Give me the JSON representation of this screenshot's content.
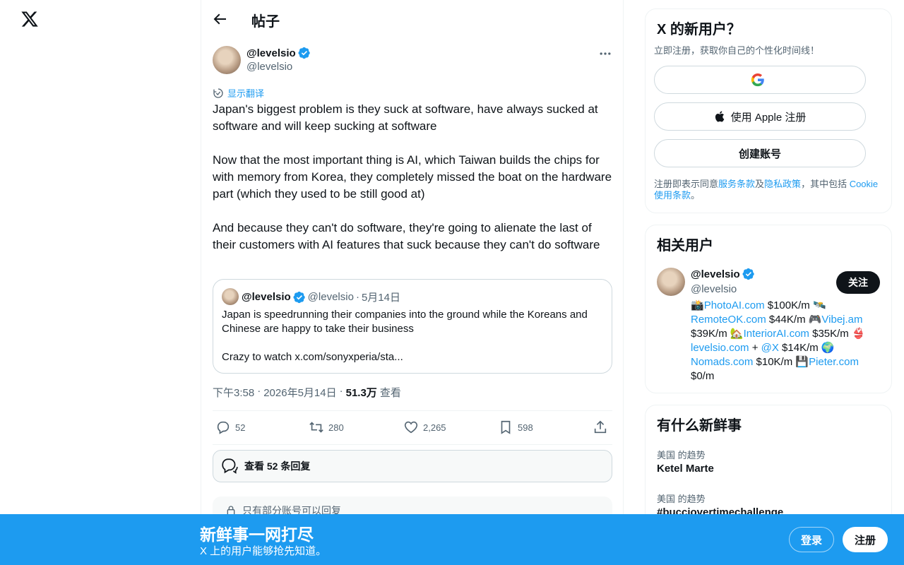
{
  "header": {
    "title": "帖子"
  },
  "tweet": {
    "author_name": "@levelsio",
    "author_handle": "@levelsio",
    "translate_label": "显示翻译",
    "paragraphs": [
      "Japan's biggest problem is they suck at software, have always sucked at software and will keep sucking at software",
      "Now that the most important thing is AI, which Taiwan builds the chips for with memory from Korea, they completely missed the boat on the hardware part (which they used to be still good at)",
      "And because they can't do software, they're going to alienate the last of their customers with AI features that suck because they can't do software"
    ],
    "quote": {
      "name": "@levelsio",
      "handle": "@levelsio",
      "dot": "·",
      "date": "5月14日",
      "paragraphs": [
        "Japan is speedrunning their companies into the ground while the Koreans and Chinese are happy to take their business",
        "Crazy to watch x.com/sonyxperia/sta..."
      ]
    },
    "meta": {
      "time": "下午3:58",
      "sep1": "·",
      "date": "2026年5月14日",
      "sep2": "·",
      "views": "51.3万",
      "views_label": "查看"
    },
    "actions": {
      "replies": "52",
      "retweets": "280",
      "likes": "2,265",
      "bookmarks": "598"
    },
    "view_replies_label": "查看 52 条回复",
    "restricted_label": "只有部分账号可以回复"
  },
  "signup": {
    "title": "X 的新用户？",
    "subtitle": "立即注册，获取你自己的个性化时间线！",
    "google_label": "",
    "apple_label": "使用 Apple 注册",
    "create_label": "创建账号",
    "terms_prefix": "注册即表示同意",
    "terms_link": "服务条款",
    "terms_and": "及",
    "privacy_link": "隐私政策",
    "terms_mid": "，其中包括 ",
    "cookie_link": "Cookie 使用条款",
    "terms_end": "。"
  },
  "related": {
    "title": "相关用户",
    "name": "@levelsio",
    "handle": "@levelsio",
    "follow_label": "关注",
    "bio": {
      "e1": "📸",
      "l1": "PhotoAI.com",
      "t1": " $100K/m ",
      "e2": "🛰️",
      "l2": "RemoteOK.com",
      "t2": " $44K/m ",
      "e3": "🎮",
      "l3": "Vibej.am",
      "t3": " $39K/m ",
      "e4": "🏡",
      "l4": "InteriorAI.com",
      "t4": " $35K/m ",
      "e5": "👙",
      "l5": "levelsio.com",
      "t5a": " + ",
      "l6": "@X",
      "t5": " $14K/m ",
      "e6": "🌍",
      "l7": "Nomads.com",
      "t6": " $10K/m ",
      "e7": "💾",
      "l8": "Pieter.com",
      "t7": " $0/m"
    }
  },
  "trends": {
    "title": "有什么新鲜事",
    "items": [
      {
        "context": "美国 的趋势",
        "name": "Ketel Marte"
      },
      {
        "context": "美国 的趋势",
        "name": "#bucciovertimechallenge"
      }
    ]
  },
  "bottom_bar": {
    "title": "新鲜事一网打尽",
    "subtitle": "X 上的用户能够抢先知道。",
    "login_label": "登录",
    "signup_label": "注册"
  },
  "colors": {
    "accent": "#1d9bf0",
    "text": "#0f1419",
    "muted": "#536471",
    "border": "#cfd9de"
  }
}
